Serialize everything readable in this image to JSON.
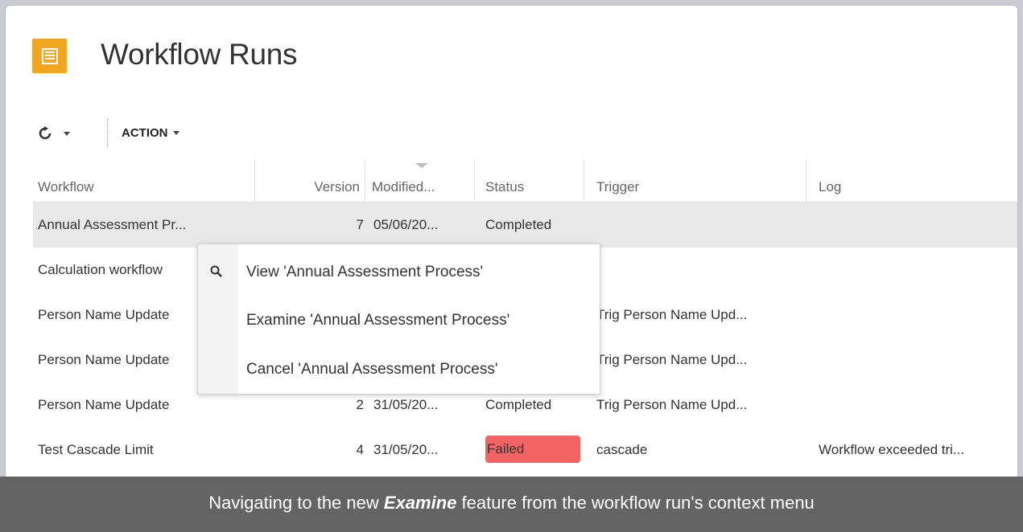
{
  "page": {
    "title": "Workflow Runs"
  },
  "toolbar": {
    "refresh_icon": "refresh-icon",
    "action_label": "ACTION"
  },
  "grid": {
    "columns": [
      "Workflow",
      "Version",
      "Modified...",
      "Status",
      "Trigger",
      "Log"
    ],
    "rows": [
      {
        "workflow": "Annual Assessment Pr...",
        "version": "7",
        "modified": "05/06/20...",
        "status": "Completed",
        "trigger": "",
        "log": ""
      },
      {
        "workflow": "Calculation workflow",
        "version": "",
        "modified": "",
        "status": "",
        "trigger": "",
        "log": ""
      },
      {
        "workflow": "Person Name Update",
        "version": "",
        "modified": "",
        "status": "",
        "trigger": "Trig Person Name Upd...",
        "log": ""
      },
      {
        "workflow": "Person Name Update",
        "version": "",
        "modified": "",
        "status": "",
        "trigger": "Trig Person Name Upd...",
        "log": ""
      },
      {
        "workflow": "Person Name Update",
        "version": "2",
        "modified": "31/05/20...",
        "status": "Completed",
        "trigger": "Trig Person Name Upd...",
        "log": ""
      },
      {
        "workflow": "Test Cascade Limit",
        "version": "4",
        "modified": "31/05/20...",
        "status": "Failed",
        "trigger": "cascade",
        "log": "Workflow exceeded tri..."
      }
    ]
  },
  "context_menu": {
    "items": [
      {
        "label": "View 'Annual Assessment Process'",
        "icon": "search-icon"
      },
      {
        "label": "Examine 'Annual Assessment Process'"
      },
      {
        "label": "Cancel 'Annual Assessment Process'"
      }
    ]
  },
  "caption": {
    "before": "Navigating to the new ",
    "emphasis": "Examine",
    "after": " feature from the workflow run's context menu"
  },
  "colors": {
    "app_icon": "#f3a61f",
    "failed": "#f16463",
    "selected_row": "#e8e8e8",
    "caption_bg": "#646464"
  }
}
